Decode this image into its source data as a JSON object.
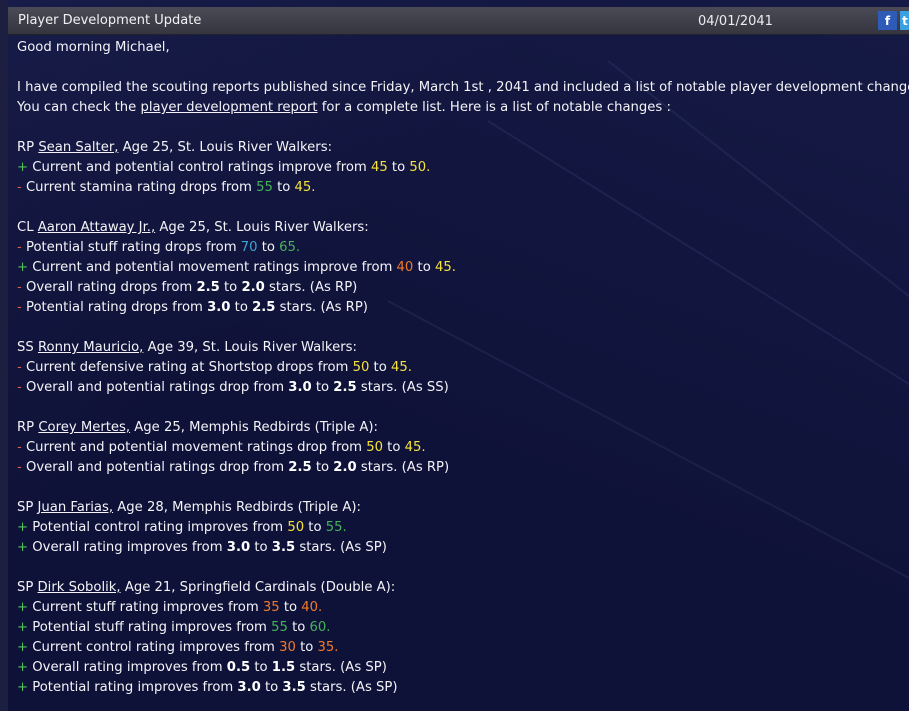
{
  "window": {
    "title": "Player Development Update",
    "date": "04/01/2041",
    "facebook_label": "f",
    "twitter_label": "t"
  },
  "greeting": "Good morning Michael,",
  "intro": {
    "line1": "I have compiled the scouting reports published since Friday, March 1st , 2041 and included a list of notable player development changes.",
    "line2_prefix": "You can check the ",
    "line2_link": "player development report",
    "line2_suffix": " for a complete list. Here is a list of notable changes :"
  },
  "players": [
    {
      "pos": "RP ",
      "name": "Sean Salter,",
      "info": " Age 25, St. Louis River Walkers:",
      "changes": [
        {
          "sign": "+",
          "text": " Current and potential control ratings improve from ",
          "v1": "45",
          "c1": "yellow",
          "mid": " to ",
          "v2": "50.",
          "c2": "yellow",
          "tail": ""
        },
        {
          "sign": "-",
          "text": " Current stamina rating drops from ",
          "v1": "55",
          "c1": "green",
          "mid": " to ",
          "v2": "45.",
          "c2": "yellow",
          "tail": ""
        }
      ]
    },
    {
      "pos": "CL ",
      "name": "Aaron Attaway Jr.,",
      "info": " Age 25, St. Louis River Walkers:",
      "changes": [
        {
          "sign": "-",
          "text": " Potential stuff rating drops from ",
          "v1": "70",
          "c1": "cyan",
          "mid": " to ",
          "v2": "65.",
          "c2": "green",
          "tail": ""
        },
        {
          "sign": "+",
          "text": " Current and potential movement ratings improve from ",
          "v1": "40",
          "c1": "orange",
          "mid": " to ",
          "v2": "45.",
          "c2": "yellow",
          "tail": ""
        },
        {
          "sign": "-",
          "text": " Overall rating drops from ",
          "v1": "2.5",
          "c1": "white",
          "mid": " to ",
          "v2": "2.0",
          "c2": "white",
          "tail": " stars. (As RP)"
        },
        {
          "sign": "-",
          "text": " Potential rating drops from ",
          "v1": "3.0",
          "c1": "white",
          "mid": " to ",
          "v2": "2.5",
          "c2": "white",
          "tail": " stars. (As RP)"
        }
      ]
    },
    {
      "pos": "SS ",
      "name": "Ronny Mauricio,",
      "info": " Age 39, St. Louis River Walkers:",
      "changes": [
        {
          "sign": "-",
          "text": " Current defensive rating at Shortstop drops from ",
          "v1": "50",
          "c1": "yellow",
          "mid": " to ",
          "v2": "45.",
          "c2": "yellow",
          "tail": ""
        },
        {
          "sign": "-",
          "text": " Overall and potential ratings drop from ",
          "v1": "3.0",
          "c1": "white",
          "mid": " to ",
          "v2": "2.5",
          "c2": "white",
          "tail": " stars. (As SS)"
        }
      ]
    },
    {
      "pos": "RP ",
      "name": "Corey Mertes,",
      "info": " Age 25, Memphis Redbirds (Triple A):",
      "changes": [
        {
          "sign": "-",
          "text": " Current and potential movement ratings drop from ",
          "v1": "50",
          "c1": "yellow",
          "mid": " to ",
          "v2": "45.",
          "c2": "yellow",
          "tail": ""
        },
        {
          "sign": "-",
          "text": " Overall and potential ratings drop from ",
          "v1": "2.5",
          "c1": "white",
          "mid": " to ",
          "v2": "2.0",
          "c2": "white",
          "tail": " stars. (As RP)"
        }
      ]
    },
    {
      "pos": "SP ",
      "name": "Juan Farias,",
      "info": " Age 28, Memphis Redbirds (Triple A):",
      "changes": [
        {
          "sign": "+",
          "text": " Potential control rating improves from ",
          "v1": "50",
          "c1": "yellow",
          "mid": " to ",
          "v2": "55.",
          "c2": "green",
          "tail": ""
        },
        {
          "sign": "+",
          "text": " Overall rating improves from ",
          "v1": "3.0",
          "c1": "white",
          "mid": " to ",
          "v2": "3.5",
          "c2": "white",
          "tail": " stars. (As SP)"
        }
      ]
    },
    {
      "pos": "SP ",
      "name": "Dirk Sobolik,",
      "info": " Age 21, Springfield Cardinals (Double A):",
      "changes": [
        {
          "sign": "+",
          "text": " Current stuff rating improves from ",
          "v1": "35",
          "c1": "orange",
          "mid": " to ",
          "v2": "40.",
          "c2": "orange",
          "tail": ""
        },
        {
          "sign": "+",
          "text": " Potential stuff rating improves from ",
          "v1": "55",
          "c1": "green",
          "mid": " to ",
          "v2": "60.",
          "c2": "green",
          "tail": ""
        },
        {
          "sign": "+",
          "text": " Current control rating improves from ",
          "v1": "30",
          "c1": "orange",
          "mid": " to ",
          "v2": "35.",
          "c2": "orange",
          "tail": ""
        },
        {
          "sign": "+",
          "text": " Overall rating improves from ",
          "v1": "0.5",
          "c1": "white",
          "mid": " to ",
          "v2": "1.5",
          "c2": "white",
          "tail": " stars. (As SP)"
        },
        {
          "sign": "+",
          "text": " Potential rating improves from ",
          "v1": "3.0",
          "c1": "white",
          "mid": " to ",
          "v2": "3.5",
          "c2": "white",
          "tail": " stars. (As SP)"
        }
      ]
    }
  ]
}
